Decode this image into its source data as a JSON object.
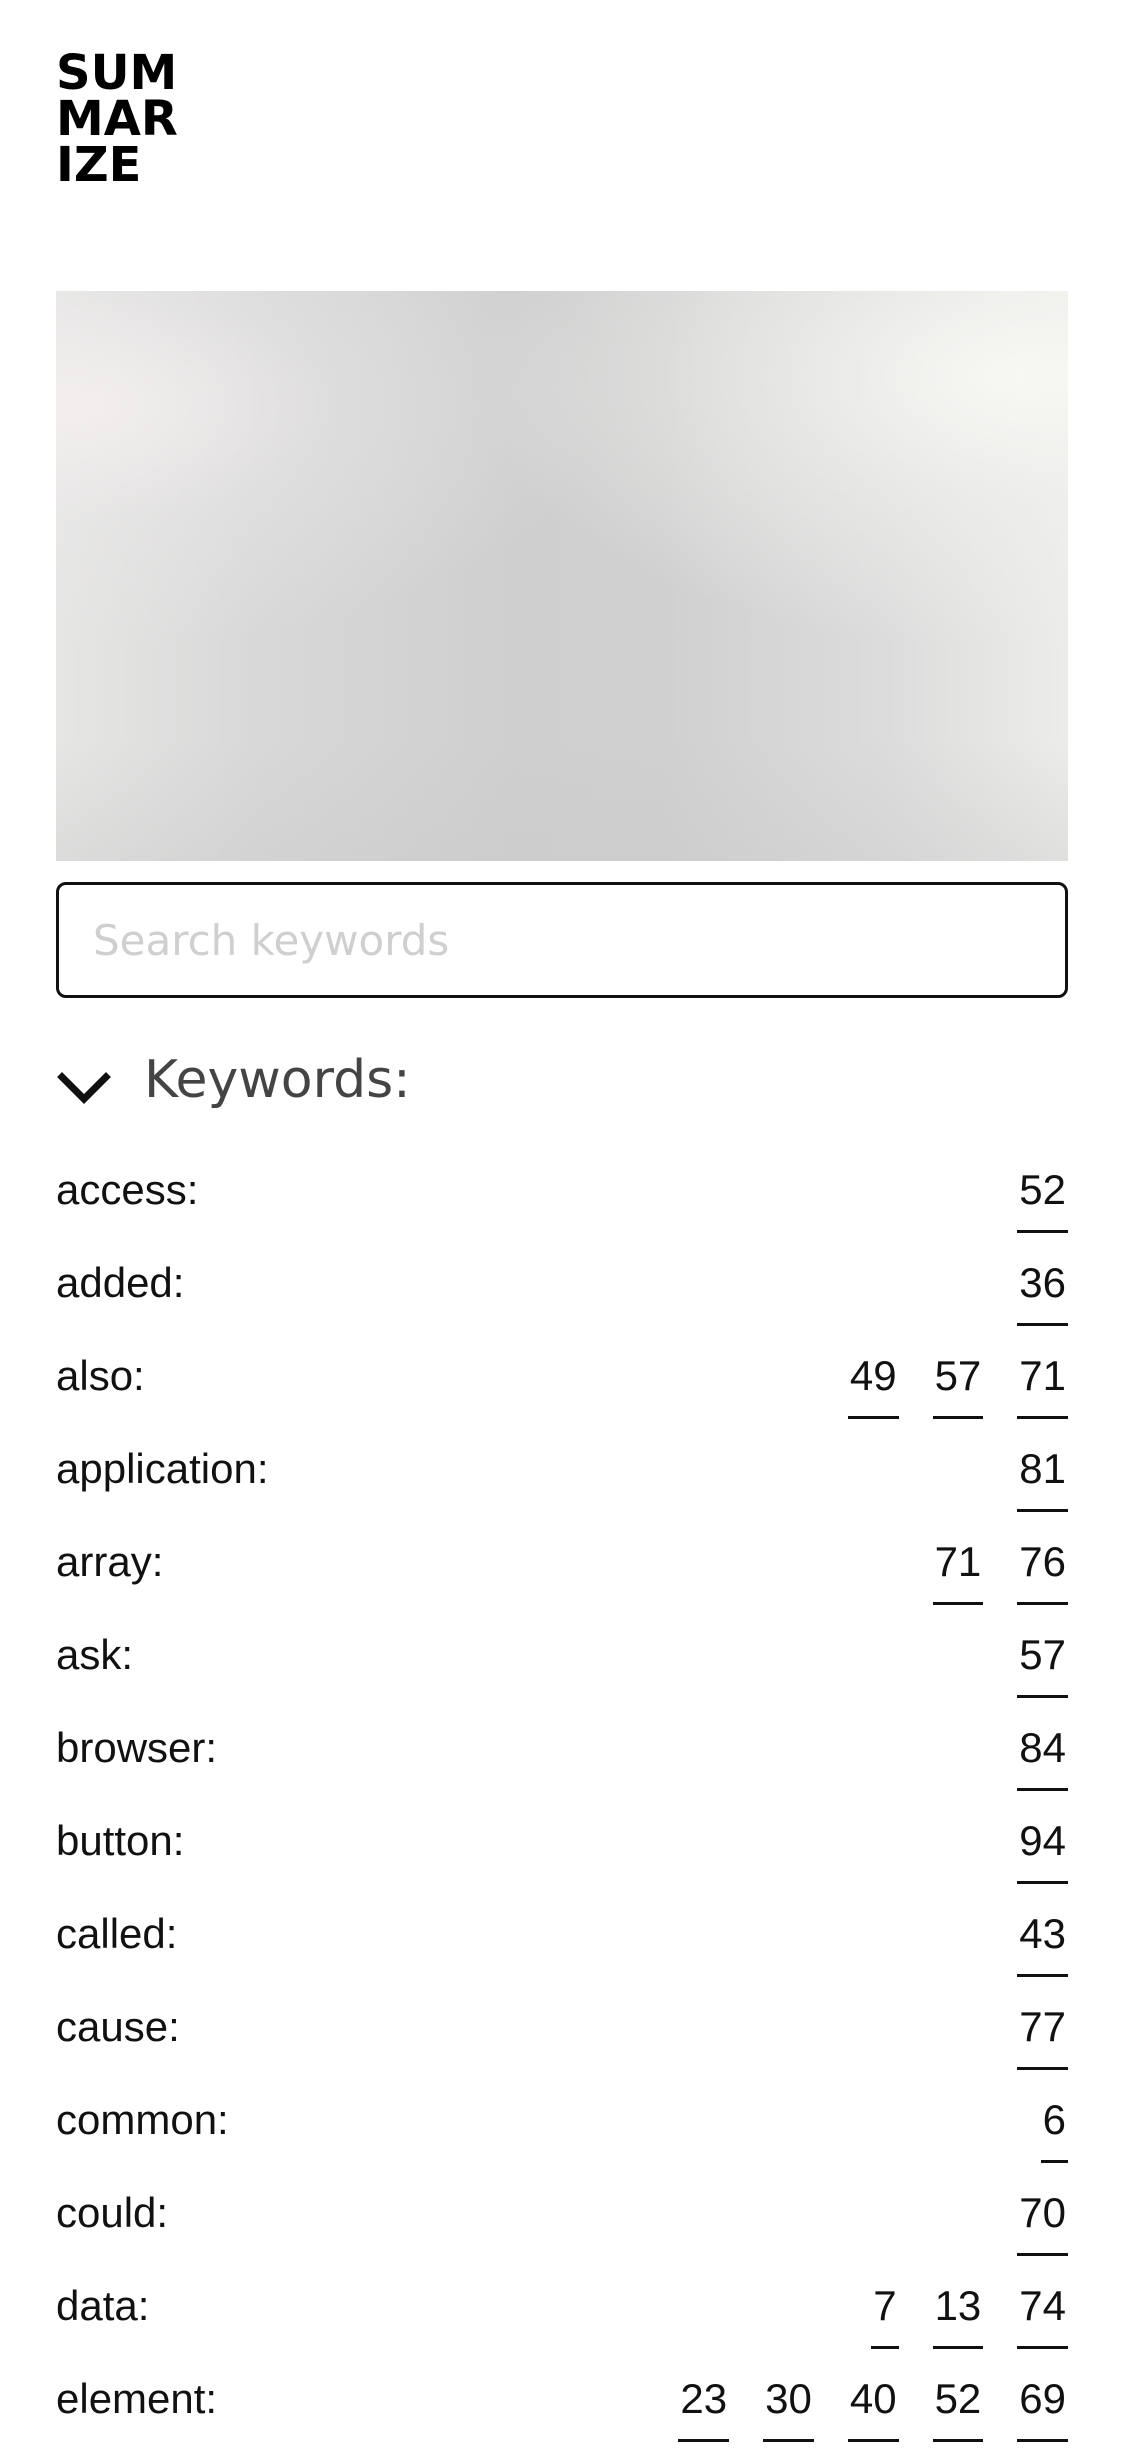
{
  "logo": {
    "lines": [
      "SUM",
      "MAR",
      "IZE"
    ]
  },
  "search": {
    "placeholder": "Search keywords",
    "value": ""
  },
  "keywords_section": {
    "title": "Keywords:",
    "expanded": true,
    "chevron_icon": "chevron-down-icon"
  },
  "keywords": [
    {
      "word": "access:",
      "refs": [
        "52"
      ]
    },
    {
      "word": "added:",
      "refs": [
        "36"
      ]
    },
    {
      "word": "also:",
      "refs": [
        "49",
        "57",
        "71"
      ]
    },
    {
      "word": "application:",
      "refs": [
        "81"
      ]
    },
    {
      "word": "array:",
      "refs": [
        "71",
        "76"
      ]
    },
    {
      "word": "ask:",
      "refs": [
        "57"
      ]
    },
    {
      "word": "browser:",
      "refs": [
        "84"
      ]
    },
    {
      "word": "button:",
      "refs": [
        "94"
      ]
    },
    {
      "word": "called:",
      "refs": [
        "43"
      ]
    },
    {
      "word": "cause:",
      "refs": [
        "77"
      ]
    },
    {
      "word": "common:",
      "refs": [
        "6"
      ]
    },
    {
      "word": "could:",
      "refs": [
        "70"
      ]
    },
    {
      "word": "data:",
      "refs": [
        "7",
        "13",
        "74"
      ]
    },
    {
      "word": "element:",
      "refs": [
        "23",
        "30",
        "40",
        "52",
        "69"
      ]
    }
  ]
}
